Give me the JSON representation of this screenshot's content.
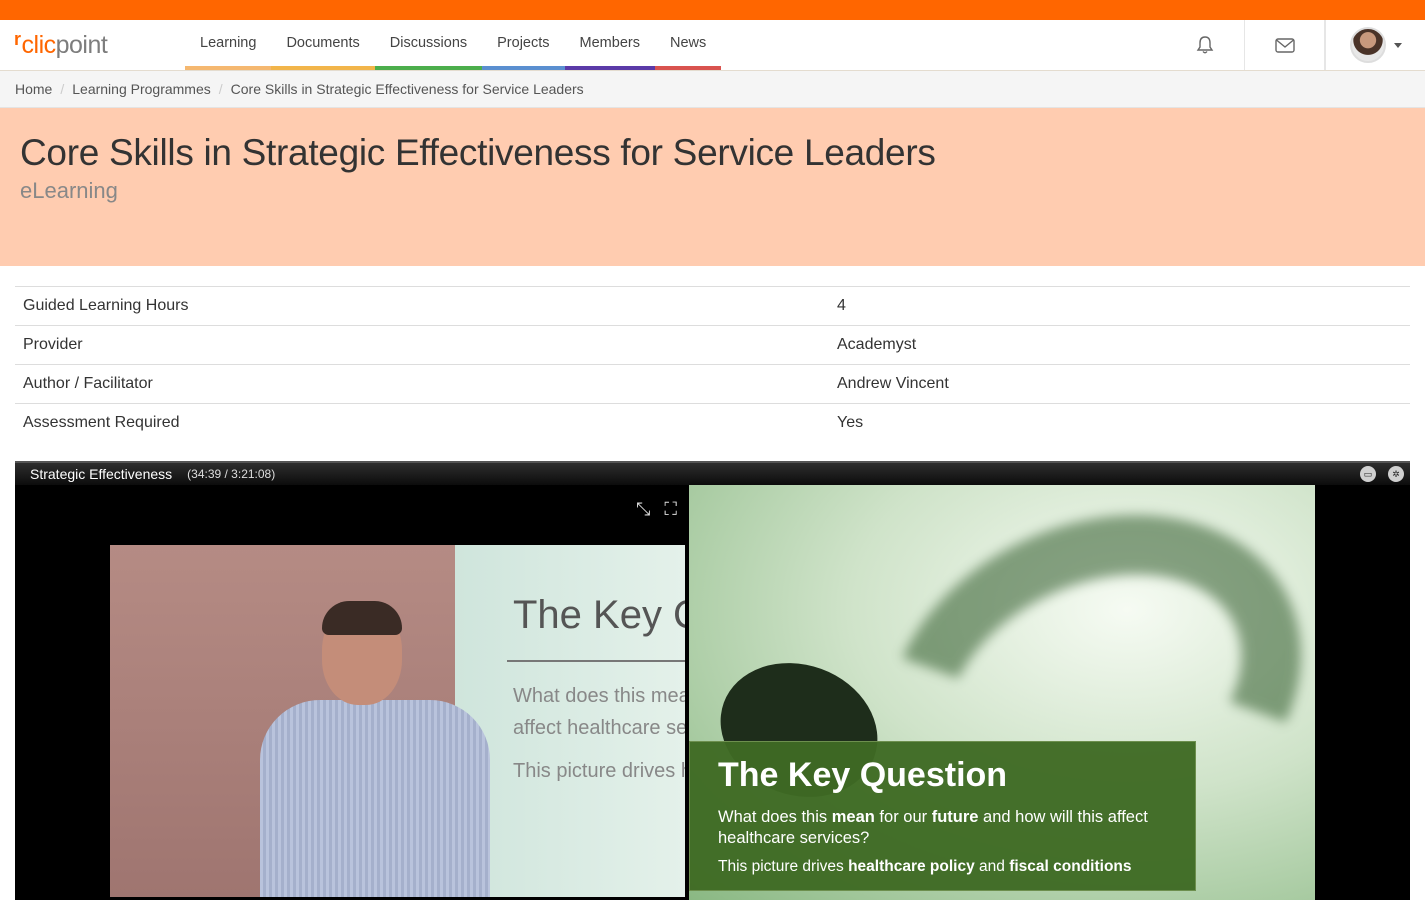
{
  "brand": {
    "name_part1": "clic",
    "name_part2": "point",
    "accent": "#ff6600"
  },
  "nav": {
    "items": [
      {
        "label": "Learning",
        "color": "#f5b870"
      },
      {
        "label": "Documents",
        "color": "#f2b54a"
      },
      {
        "label": "Discussions",
        "color": "#4cae4c"
      },
      {
        "label": "Projects",
        "color": "#5a8fd0"
      },
      {
        "label": "Members",
        "color": "#5b3aa8"
      },
      {
        "label": "News",
        "color": "#d9534f"
      }
    ],
    "icons": [
      "bell-icon",
      "envelope-icon",
      "avatar"
    ]
  },
  "breadcrumb": [
    "Home",
    "Learning Programmes",
    "Core Skills in Strategic Effectiveness for Service Leaders"
  ],
  "hero": {
    "title": "Core Skills in Strategic Effectiveness for Service Leaders",
    "subtitle": "eLearning",
    "background": "#ffccb0"
  },
  "details": [
    {
      "label": "Guided Learning Hours",
      "value": "4"
    },
    {
      "label": "Provider",
      "value": "Academyst"
    },
    {
      "label": "Author / Facilitator",
      "value": "Andrew Vincent"
    },
    {
      "label": "Assessment Required",
      "value": "Yes"
    }
  ],
  "player": {
    "title": "Strategic Effectiveness",
    "time": "(34:39 / 3:21:08)",
    "slide_in_video": {
      "heading": "The Key Qu",
      "line1": "What does this mea",
      "line2": "affect healthcare se",
      "line3": "This picture drives heal"
    },
    "slide": {
      "title": "The Key Question",
      "p1_a": "What does this ",
      "p1_b": "mean",
      "p1_c": " for our ",
      "p1_d": "future",
      "p1_e": " and how will this affect healthcare services?",
      "p2_a": "This picture drives ",
      "p2_b": "healthcare policy",
      "p2_c": " and ",
      "p2_d": "fiscal conditions"
    }
  }
}
